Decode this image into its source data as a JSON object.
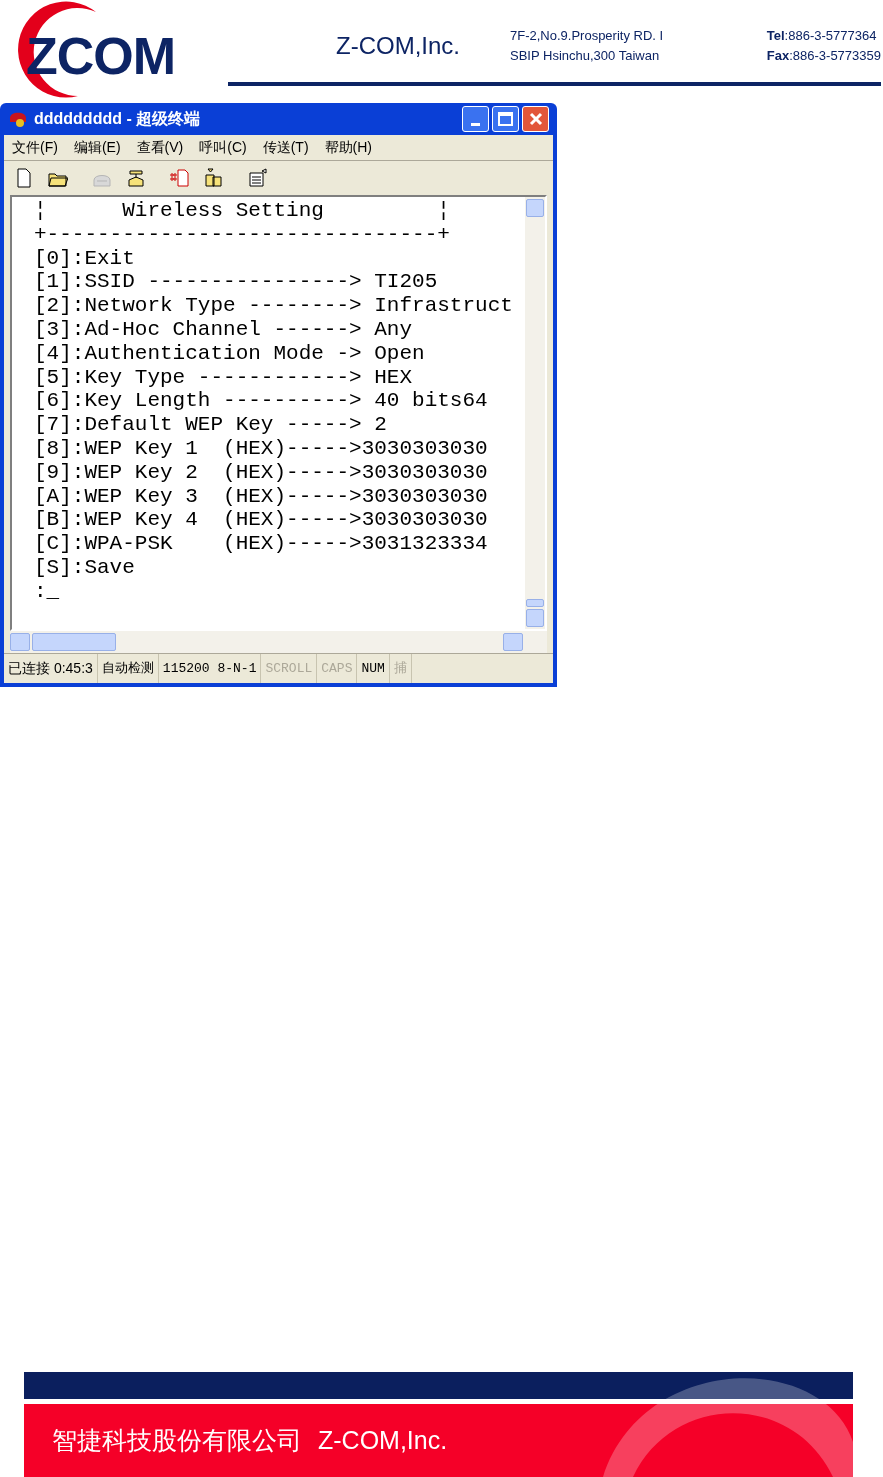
{
  "header": {
    "logo": "ZCOM",
    "company": "Z-COM,Inc.",
    "address": [
      "7F-2,No.9.Prosperity RD. I",
      "SBIP Hsinchu,300 Taiwan"
    ],
    "contacts": [
      "**Tel**:886-3-5777364",
      "**Fax**:886-3-5773359"
    ]
  },
  "window": {
    "title": "ddddddddd - 超级终端",
    "menu": [
      "文件(F)",
      "编辑(E)",
      "查看(V)",
      "呼叫(C)",
      "传送(T)",
      "帮助(H)"
    ],
    "toolbar": [
      {
        "kind": "new-file",
        "disabled": false
      },
      {
        "kind": "open-folder",
        "disabled": false
      },
      {
        "kind": "phone",
        "disabled": true
      },
      {
        "kind": "phone-dial",
        "disabled": false
      },
      {
        "kind": "send-file",
        "disabled": false
      },
      {
        "kind": "receive-file",
        "disabled": false
      },
      {
        "kind": "properties",
        "disabled": false
      }
    ],
    "terminal_lines": [
      "¦      Wireless Setting         ¦",
      "+-------------------------------+",
      "[0]:Exit",
      "[1]:SSID ----------------> TI205",
      "[2]:Network Type --------> Infrastruct",
      "[3]:Ad-Hoc Channel ------> Any",
      "[4]:Authentication Mode -> Open",
      "[5]:Key Type ------------> HEX",
      "[6]:Key Length ----------> 40 bits64",
      "[7]:Default WEP Key -----> 2",
      "[8]:WEP Key 1  (HEX)----->3030303030",
      "[9]:WEP Key 2  (HEX)----->3030303030",
      "[A]:WEP Key 3  (HEX)----->3030303030",
      "[B]:WEP Key 4  (HEX)----->3030303030",
      "[C]:WPA-PSK    (HEX)----->3031323334",
      "[S]:Save",
      ":_"
    ],
    "status_bar": [
      {
        "text": "已连接 0:45:3",
        "on": true
      },
      {
        "text": "自动检测",
        "on": true
      },
      {
        "text": "115200 8-N-1",
        "on": true
      },
      {
        "text": "SCROLL",
        "on": false
      },
      {
        "text": "CAPS",
        "on": false
      },
      {
        "text": "NUM",
        "on": true
      },
      {
        "text": "捕",
        "on": false
      }
    ]
  },
  "footer": {
    "company_cn": "智捷科技股份有限公司",
    "company_en": "Z-COM,Inc."
  }
}
